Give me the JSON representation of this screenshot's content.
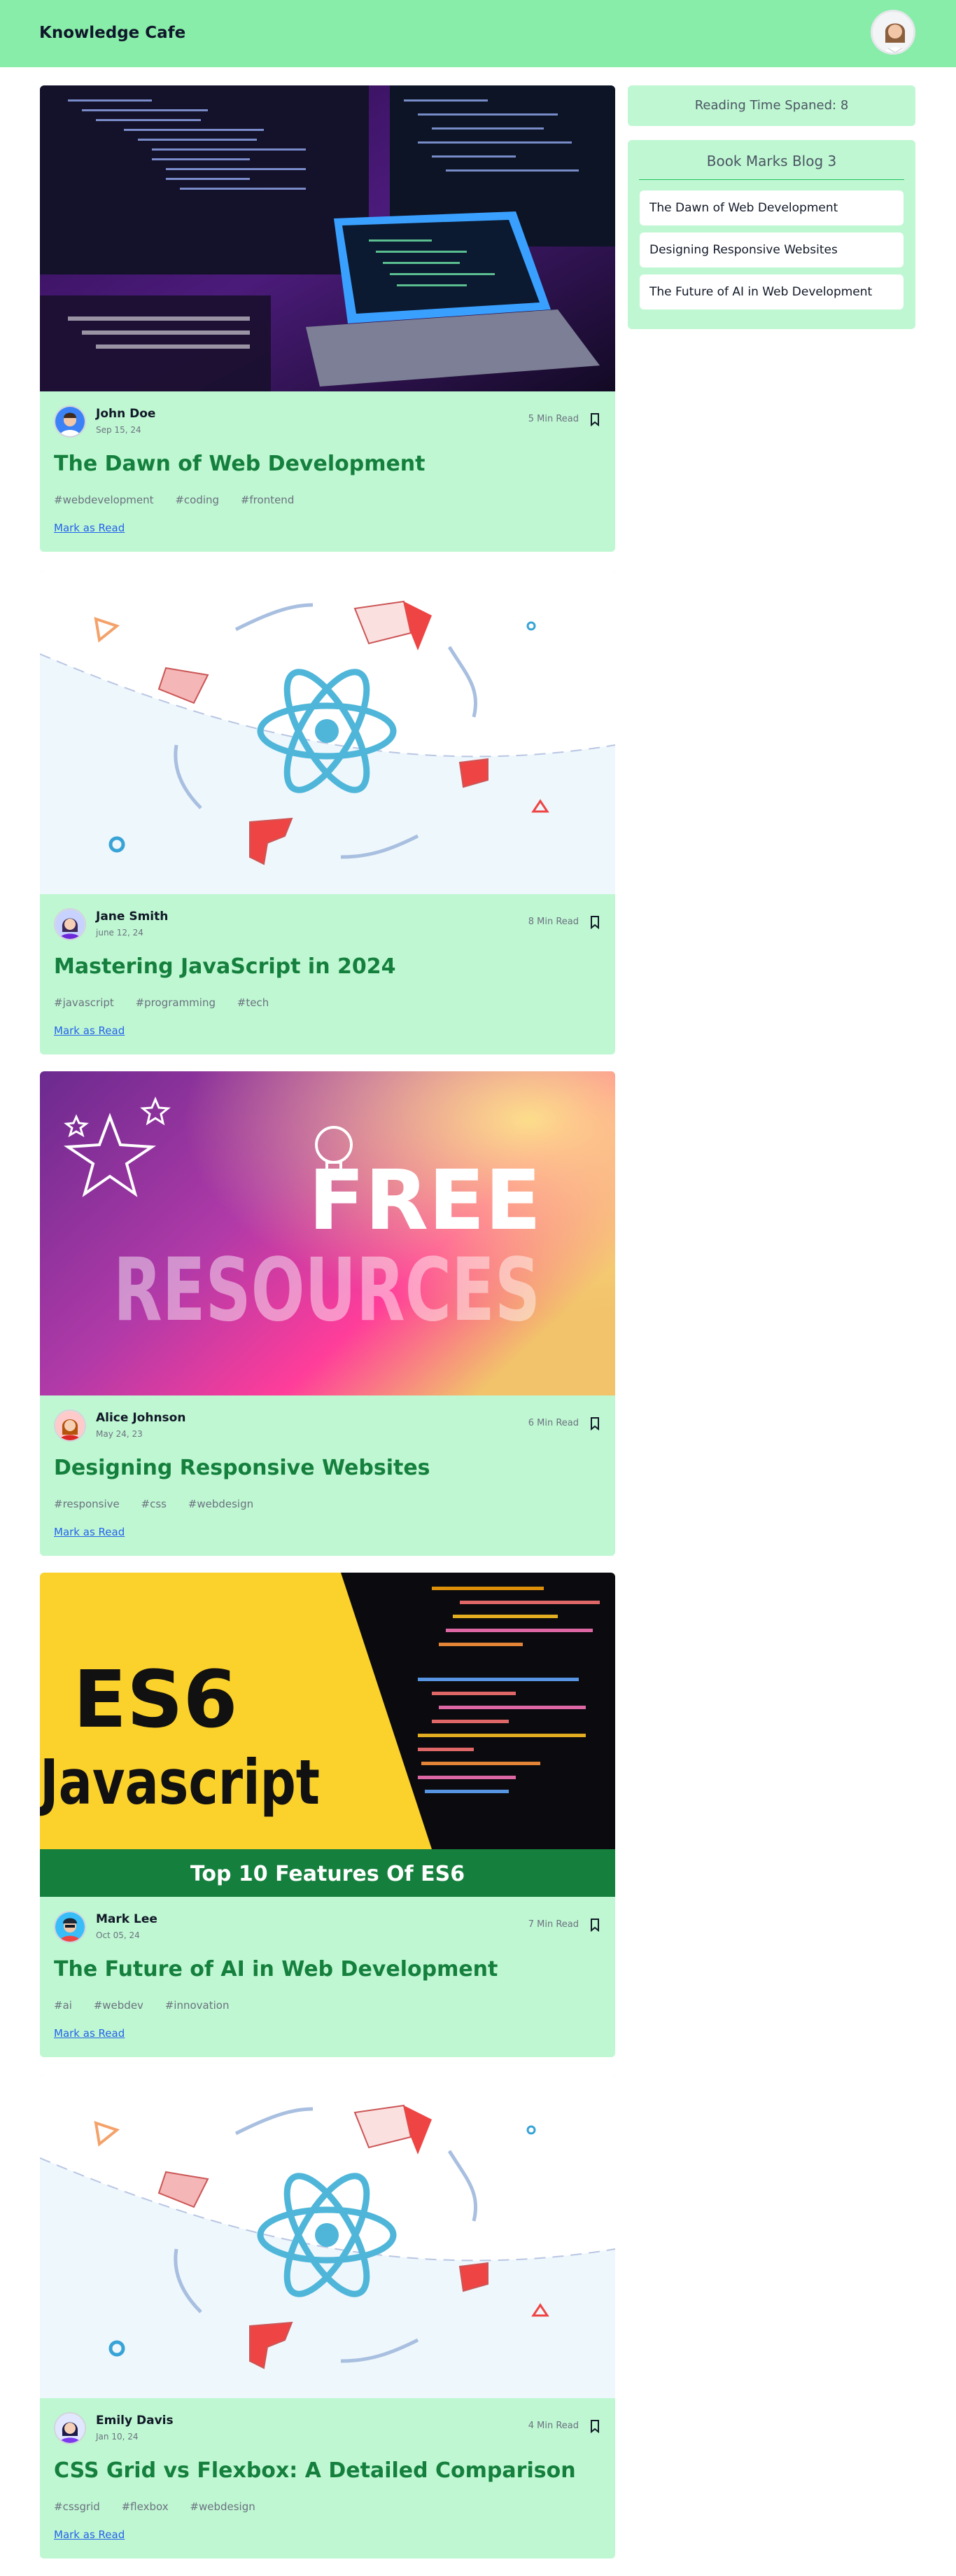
{
  "header": {
    "brand": "Knowledge Cafe",
    "avatar_icon": "profile-avatar-icon"
  },
  "sidebar": {
    "reading_time_label": "Reading Time Spaned: 8",
    "bookmarks_title": "Book Marks Blog 3",
    "bookmarks": [
      "The Dawn of Web Development",
      "Designing Responsive Websites",
      "The Future of AI in Web Development"
    ]
  },
  "posts": [
    {
      "author": "John Doe",
      "date": "Sep 15, 24",
      "read_time": "5 Min Read",
      "title": "The Dawn of Web Development",
      "tags": [
        "#webdevelopment",
        "#coding",
        "#frontend"
      ],
      "mark_read": "Mark as Read",
      "cover": "laptop-code-photo"
    },
    {
      "author": "Jane Smith",
      "date": "june 12, 24",
      "read_time": "8 Min Read",
      "title": "Mastering JavaScript in 2024",
      "tags": [
        "#javascript",
        "#programming",
        "#tech"
      ],
      "mark_read": "Mark as Read",
      "cover": "react-logo-illustration"
    },
    {
      "author": "Alice Johnson",
      "date": "May 24, 23",
      "read_time": "6 Min Read",
      "title": "Designing Responsive Websites",
      "tags": [
        "#responsive",
        "#css",
        "#webdesign"
      ],
      "mark_read": "Mark as Read",
      "cover": "free-resources-banner",
      "cover_text": {
        "line1": "FREE",
        "line2": "RESOURCES"
      }
    },
    {
      "author": "Mark Lee",
      "date": "Oct 05, 24",
      "read_time": "7 Min Read",
      "title": "The Future of AI in Web Development",
      "tags": [
        "#ai",
        "#webdev",
        "#innovation"
      ],
      "mark_read": "Mark as Read",
      "cover": "es6-javascript-banner",
      "cover_text": {
        "line1": "ES6",
        "line2": "Javascript",
        "banner": "Top 10 Features Of ES6"
      }
    },
    {
      "author": "Emily Davis",
      "date": "Jan 10, 24",
      "read_time": "4 Min Read",
      "title": "CSS Grid vs Flexbox: A Detailed Comparison",
      "tags": [
        "#cssgrid",
        "#flexbox",
        "#webdesign"
      ],
      "mark_read": "Mark as Read",
      "cover": "react-logo-illustration"
    }
  ]
}
